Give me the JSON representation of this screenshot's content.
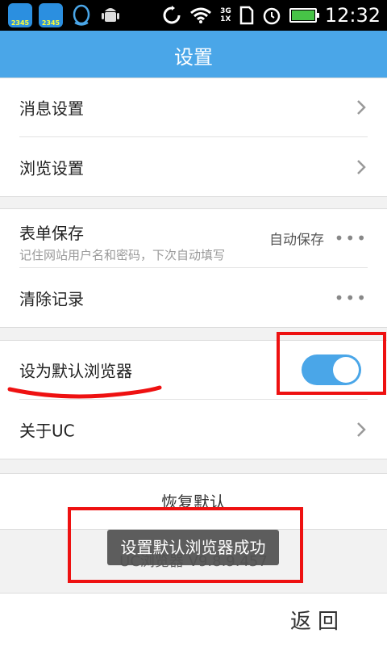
{
  "status_bar": {
    "app1_label": "2345",
    "app2_label": "2345",
    "network_top": "3G",
    "network_bottom": "1X",
    "time": "12:32"
  },
  "header": {
    "title": "设置"
  },
  "group1": {
    "items": [
      {
        "label": "消息设置"
      },
      {
        "label": "浏览设置"
      }
    ]
  },
  "group2": {
    "form_save": {
      "label": "表单保存",
      "sub": "记住网站用户名和密码，下次自动填写",
      "value": "自动保存",
      "more": "•••"
    },
    "clear": {
      "label": "清除记录",
      "more": "•••"
    }
  },
  "group3": {
    "default_browser": {
      "label": "设为默认浏览器",
      "toggle_on": true
    },
    "about": {
      "label": "关于UC"
    }
  },
  "restore": {
    "label": "恢复默认"
  },
  "version": {
    "text": "UC浏览器 V9.8.9.457"
  },
  "toast": {
    "text": "设置默认浏览器成功"
  },
  "bottom": {
    "back_label": "返回"
  },
  "colors": {
    "accent": "#4aa6e8",
    "annotation_red": "#ee1111",
    "background": "#f2f2f2"
  }
}
